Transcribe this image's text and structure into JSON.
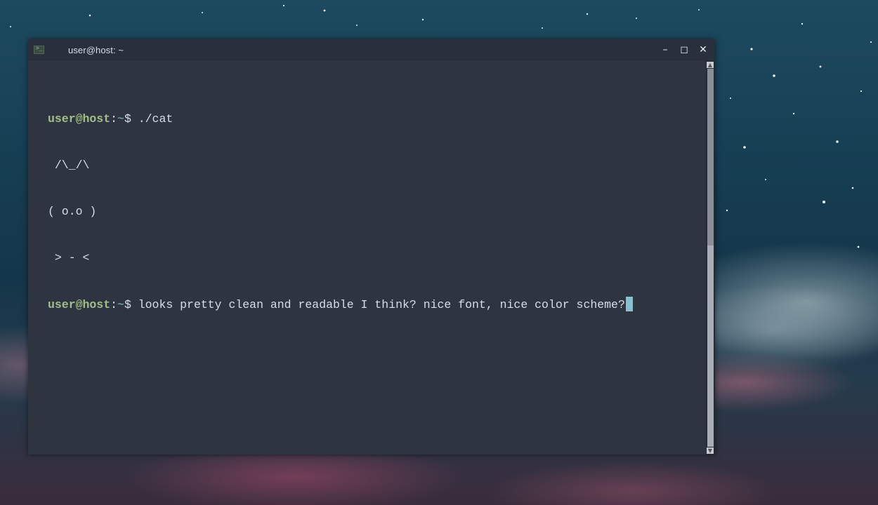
{
  "window": {
    "title": "user@host: ~",
    "app_icon": "terminal-icon",
    "controls": {
      "minimize": "minimize-icon",
      "maximize": "maximize-icon",
      "close": "close-icon"
    }
  },
  "terminal": {
    "prompt": {
      "user": "user@host",
      "sep": ":",
      "path": "~",
      "symbol": "$ "
    },
    "command_1": "./cat",
    "output": [
      " /\\_/\\",
      "( o.o )",
      " > - <"
    ],
    "command_2": "looks pretty clean and readable I think? nice font, nice color scheme?"
  },
  "colors": {
    "background": "#2e3440",
    "foreground": "#d8dee9",
    "prompt_user": "#a3be8c",
    "prompt_path": "#8fbcbb",
    "cursor": "#88c0d0"
  }
}
